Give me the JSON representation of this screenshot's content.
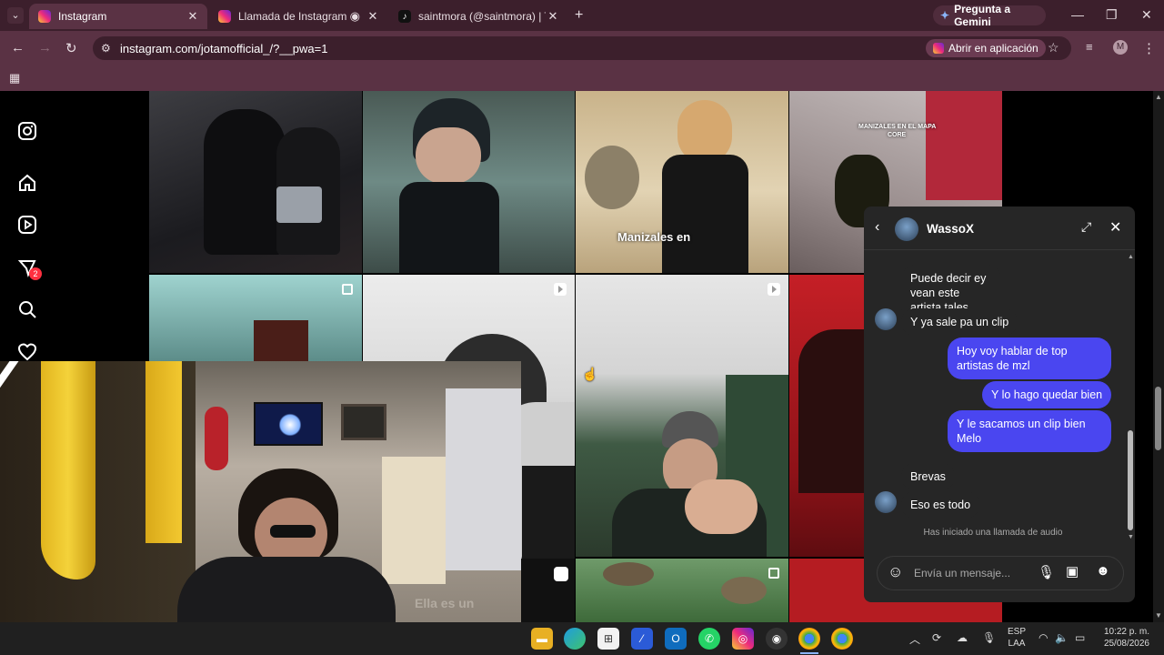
{
  "tabs": [
    {
      "title": "Instagram",
      "active": true
    },
    {
      "title": "Llamada de Instagram",
      "active": false
    },
    {
      "title": "saintmora (@saintmora) | TikTok",
      "active": false
    }
  ],
  "gemini_label": "Pregunta a Gemini",
  "url": "instagram.com/jotamofficial_/?__pwa=1",
  "open_app_label": "Abrir en aplicación",
  "profile_initial": "M",
  "notifications_count": "2",
  "tile_captions": {
    "manizales": "Manizales en",
    "manizales_map_line1": "MANIZALES EN EL MAPA",
    "manizales_map_line2": "CORE",
    "webcam_subtitle": "Ella es un"
  },
  "chat": {
    "contact_name": "WassoX",
    "messages": [
      {
        "text": "Puede decir ey vean este artista tales",
        "from": "them"
      },
      {
        "text": "Y ya sale pa un clip",
        "from": "them"
      },
      {
        "text": "Hoy voy hablar de top artistas de mzl",
        "from": "me"
      },
      {
        "text": "Y lo hago quedar bien",
        "from": "me"
      },
      {
        "text": "Y le sacamos un clip bien Melo",
        "from": "me"
      },
      {
        "text": "Brevas",
        "from": "them"
      },
      {
        "text": "Eso es todo",
        "from": "them"
      }
    ],
    "system_note": "Has iniciado una llamada de audio",
    "input_placeholder": "Envía un mensaje..."
  },
  "taskbar": {
    "lang_line1": "ESP",
    "lang_line2": "LAA",
    "time": "10:22 p. m.",
    "date": "25/08/2026"
  },
  "colors": {
    "chrome_dark": "#3c1f2c",
    "chrome_light": "#5a3244",
    "outgoing_bubble": "#4a46f0",
    "chat_bg": "#262626"
  }
}
